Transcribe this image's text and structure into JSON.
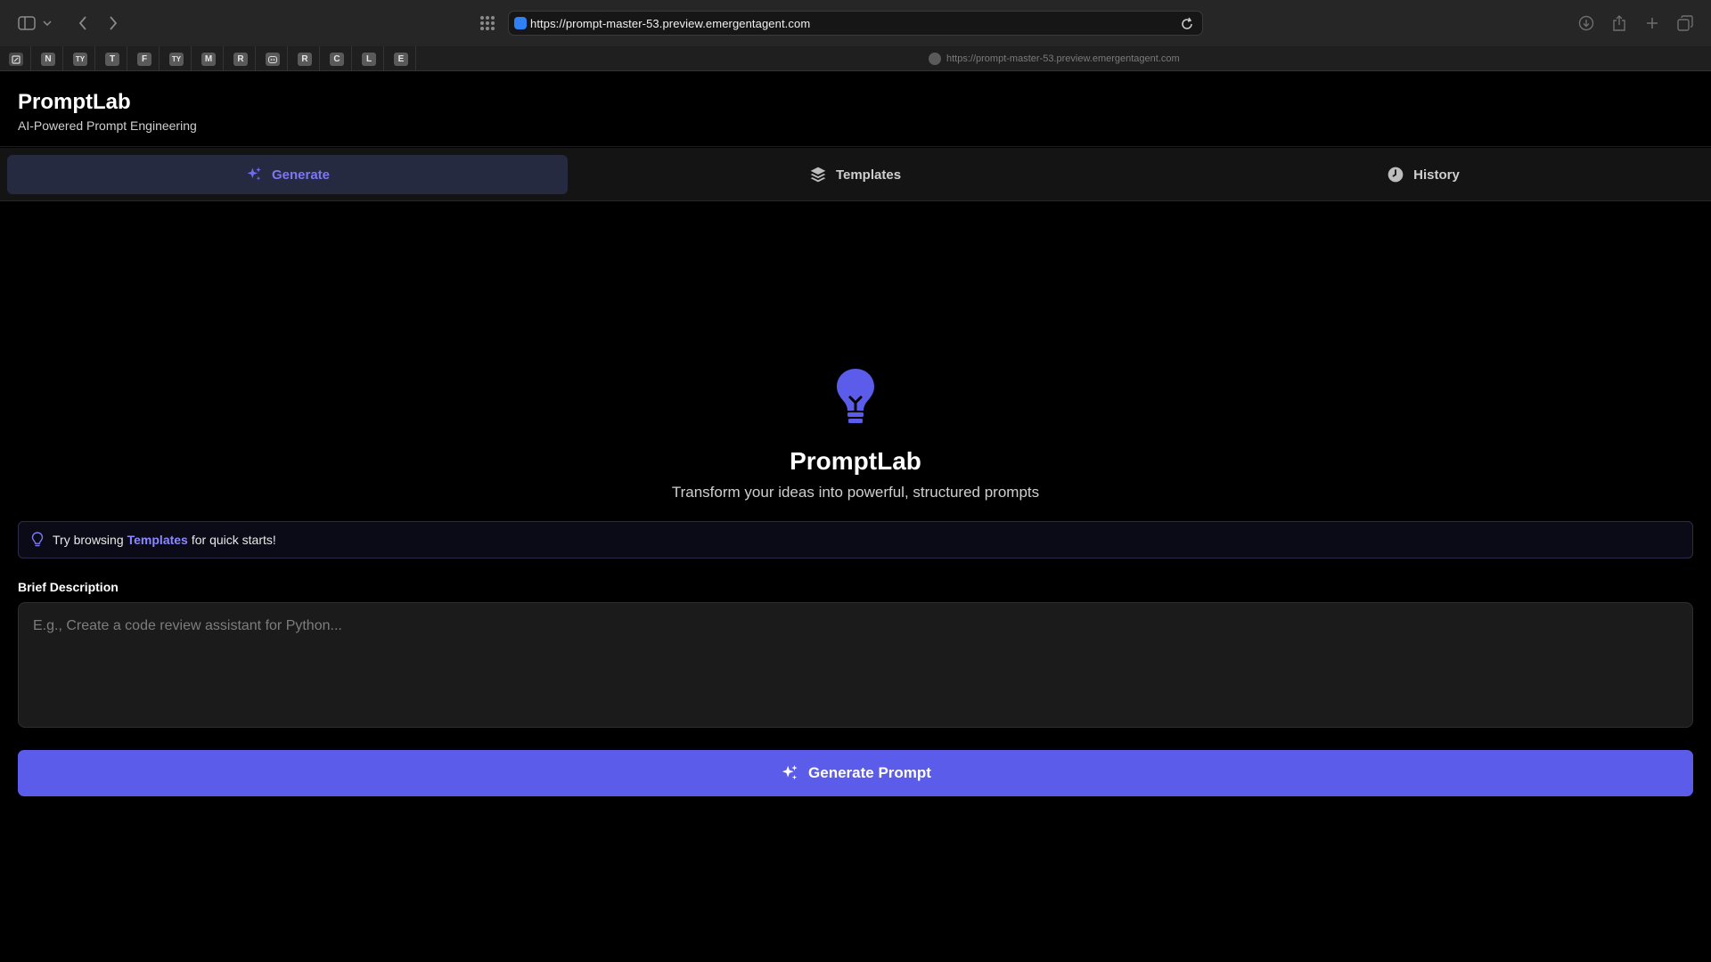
{
  "browser": {
    "url": "https://prompt-master-53.preview.emergentagent.com",
    "hover_url": "https://prompt-master-53.preview.emergentagent.com",
    "favorites": [
      "N",
      "TY",
      "T",
      "F",
      "TY",
      "M",
      "R",
      "R",
      "C",
      "L",
      "E"
    ]
  },
  "header": {
    "title": "PromptLab",
    "subtitle": "AI-Powered Prompt Engineering"
  },
  "nav": {
    "tabs": [
      {
        "label": "Generate",
        "icon": "sparkles-icon",
        "active": true
      },
      {
        "label": "Templates",
        "icon": "layers-icon",
        "active": false
      },
      {
        "label": "History",
        "icon": "clock-icon",
        "active": false
      }
    ]
  },
  "hero": {
    "icon": "lightbulb-icon",
    "title": "PromptLab",
    "subtitle": "Transform your ideas into powerful, structured prompts"
  },
  "tip": {
    "prefix": "Try browsing",
    "link": "Templates",
    "suffix": "for quick starts!"
  },
  "form": {
    "label": "Brief Description",
    "value": "",
    "placeholder": "E.g., Create a code review assistant for Python...",
    "button_label": "Generate Prompt"
  },
  "colors": {
    "accent": "#5b5ce9",
    "accent_text": "#7c77f0",
    "background": "#000000"
  }
}
